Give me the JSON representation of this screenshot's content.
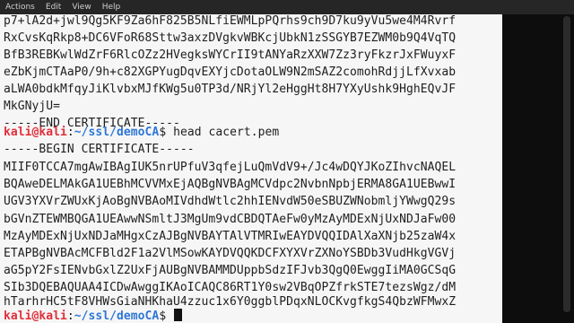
{
  "menu": {
    "items": [
      "Actions",
      "Edit",
      "View",
      "Help"
    ]
  },
  "terminal": {
    "lines_before": [
      "p7+lA2d+jwl9Qg5KF9Za6hF825B5NLfiEWMLpPQrhs9ch9D7ku9yVu5we4M4Rvrf",
      "RxCvsKqRkp8+DC6VFoR68Sttw3axzDVgkvWBKcjUbkN1zSSGYB7EZWM0b9Q4VqTQ",
      "BfB3REBKwlWdZrF6RlcOZz2HVegksWYCrII9tANYaRzXXW7Zz3ryFkzrJxFWuyxF",
      "eZbKjmCTAaP0/9h+c82XGPYugDqvEXYjcDotaOLW9N2mSAZ2comohRdjjLfXvxab",
      "aLWA0bdkMfqyJiKlvbxMJfKWg5u0TP3d/NRjYl2eHggHt8H7YXyUshk9HghEQvJF",
      "MkGNyjU=",
      "-----END CERTIFICATE-----"
    ],
    "prompt": {
      "user": "kali@kali",
      "sep": ":",
      "path": "~/ssl/demoCA",
      "sym": "$ "
    },
    "command": "head cacert.pem",
    "lines_after": [
      "-----BEGIN CERTIFICATE-----",
      "MIIF0TCCA7mgAwIBAgIUK5nrUPfuV3qfejLuQmVdV9+/Jc4wDQYJKoZIhvcNAQEL",
      "BQAweDELMAkGA1UEBhMCVVMxEjAQBgNVBAgMCVdpc2NvbnNpbjERMA8GA1UEBwwI",
      "UGV3YXVrZWUxKjAoBgNVBAoMIVdhdWtlc2hhIENvdW50eSBUZWNobmljYWwgQ29s",
      "bGVnZTEWMBQGA1UEAwwNSmltJ3MgUm9vdCBDQTAeFw0yMzAyMDExNjUxNDJaFw00",
      "MzAyMDExNjUxNDJaMHgxCzAJBgNVBAYTAlVTMRIwEAYDVQQIDAlXaXNjb25zaW4x",
      "ETAPBgNVBAcMCFBld2F1a2VlMSowKAYDVQQKDCFXYXVrZXNoYSBDb3VudHkgVGVj",
      "aG5pY2FsIENvbGxlZ2UxFjAUBgNVBAMMDUppbSdzIFJvb3QgQ0EwggIiMA0GCSqG",
      "SIb3DQEBAQUAA4ICDwAwggIKAoICAQC86RT1Y0sw2VBqOPZfrkSTE7tezsWgz/dM",
      "hTarhrHC5tF8VHWsGiaNHKhaU4zzuc1x6Y0ggblPDqxNLOCKvgfkgS4QbzWFMwxZ"
    ],
    "prompt2": {
      "user": "kali@kali",
      "sep": ":",
      "path": "~/ssl/demoCA",
      "sym": "$ "
    }
  }
}
